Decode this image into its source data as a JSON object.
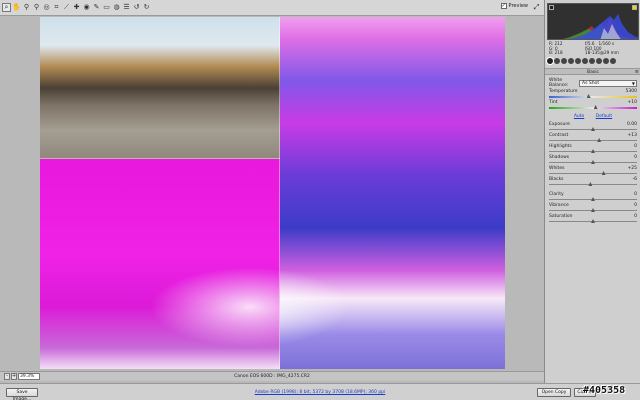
{
  "toolbar": {
    "tools": [
      {
        "name": "zoom-tool",
        "icon": "magnifier-icon",
        "glyph": "⌕"
      },
      {
        "name": "hand-tool",
        "icon": "hand-icon",
        "glyph": "✋"
      },
      {
        "name": "white-balance-tool",
        "icon": "eyedropper-icon",
        "glyph": "⚲"
      },
      {
        "name": "color-sampler-tool",
        "icon": "color-sampler-icon",
        "glyph": "⚲"
      },
      {
        "name": "targeted-adjustment-tool",
        "icon": "target-icon",
        "glyph": "◎"
      },
      {
        "name": "crop-tool",
        "icon": "crop-icon",
        "glyph": "⌗"
      },
      {
        "name": "straighten-tool",
        "icon": "straighten-icon",
        "glyph": "⟋"
      },
      {
        "name": "spot-removal-tool",
        "icon": "spot-removal-icon",
        "glyph": "✚"
      },
      {
        "name": "red-eye-tool",
        "icon": "red-eye-icon",
        "glyph": "◉"
      },
      {
        "name": "adjustment-brush-tool",
        "icon": "brush-icon",
        "glyph": "✎"
      },
      {
        "name": "graduated-filter-tool",
        "icon": "graduated-filter-icon",
        "glyph": "▭"
      },
      {
        "name": "radial-filter-tool",
        "icon": "radial-filter-icon",
        "glyph": "◍"
      },
      {
        "name": "preferences-tool",
        "icon": "preferences-icon",
        "glyph": "☰"
      },
      {
        "name": "rotate-left-tool",
        "icon": "rotate-left-icon",
        "glyph": "↺"
      },
      {
        "name": "rotate-right-tool",
        "icon": "rotate-right-icon",
        "glyph": "↻"
      }
    ],
    "preview_label": "Preview",
    "preview_check": "✓",
    "expand_glyph": "⤢"
  },
  "status": {
    "zoom_value": "39.3%",
    "zoom_minus": "-",
    "zoom_plus": "+",
    "filename": "Canon EOS 600D  :  IMG_4275.CR2"
  },
  "bottom": {
    "save_label": "Save Image...",
    "workflow_text": "Adobe RGB (1998); 8 bit; 5372 by 3708 (18.6MP); 360 ppi",
    "open_label": "Open Copy",
    "cancel_label": "Cancel",
    "watermark": "#405358"
  },
  "readout": {
    "r": "R:  212",
    "g": "G:    0",
    "b": "B:  218",
    "aperture": "f/5.6",
    "shutter": "1/160 s",
    "iso": "ISO 100",
    "lens": "18-135@29 mm"
  },
  "panel": {
    "section_title": "Basic",
    "menu_glyph": "≡",
    "white_balance_label": "White Balance:",
    "white_balance_value": "As Shot",
    "auto_label": "Auto",
    "default_label": "Default",
    "sliders": {
      "temperature": {
        "label": "Temperature",
        "value": "5300",
        "pos": 0.45
      },
      "tint": {
        "label": "Tint",
        "value": "+10",
        "pos": 0.53
      },
      "exposure": {
        "label": "Exposure",
        "value": "0.00",
        "pos": 0.5
      },
      "contrast": {
        "label": "Contrast",
        "value": "+13",
        "pos": 0.57
      },
      "highlights": {
        "label": "Highlights",
        "value": "0",
        "pos": 0.5
      },
      "shadows": {
        "label": "Shadows",
        "value": "0",
        "pos": 0.5
      },
      "whites": {
        "label": "Whites",
        "value": "+25",
        "pos": 0.62
      },
      "blacks": {
        "label": "Blacks",
        "value": "-6",
        "pos": 0.47
      },
      "clarity": {
        "label": "Clarity",
        "value": "0",
        "pos": 0.5
      },
      "vibrance": {
        "label": "Vibrance",
        "value": "0",
        "pos": 0.5
      },
      "saturation": {
        "label": "Saturation",
        "value": "0",
        "pos": 0.5
      }
    }
  },
  "colors": {
    "accent_link": "#1a3cc8",
    "highlight_clip": "#f2d400"
  }
}
